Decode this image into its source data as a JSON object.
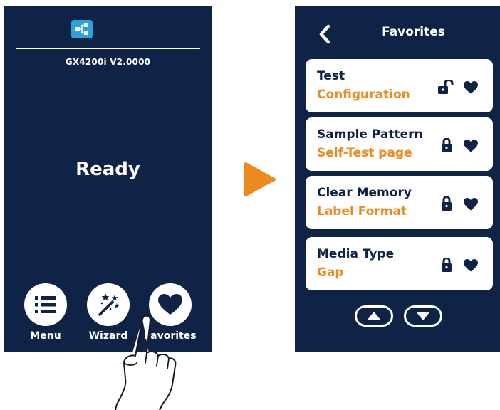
{
  "left_screen": {
    "model_version": "GX4200i V2.0000",
    "status": "Ready",
    "buttons": [
      {
        "label": "Menu",
        "icon": "menu-list-icon"
      },
      {
        "label": "Wizard",
        "icon": "magic-wand-icon"
      },
      {
        "label": "Favorites",
        "icon": "heart-icon"
      }
    ],
    "network_icon": "network-icon"
  },
  "right_screen": {
    "title": "Favorites",
    "items": [
      {
        "title": "Test",
        "subtitle": "Configuration",
        "lock": "unlocked",
        "favorite": true
      },
      {
        "title": "Sample Pattern",
        "subtitle": "Self-Test page",
        "lock": "locked",
        "favorite": true
      },
      {
        "title": "Clear Memory",
        "subtitle": "Label Format",
        "lock": "locked",
        "favorite": true
      },
      {
        "title": "Media Type",
        "subtitle": "Gap",
        "lock": "locked",
        "favorite": true
      }
    ],
    "scroll_buttons": [
      "scroll-up-icon",
      "scroll-down-icon"
    ]
  },
  "colors": {
    "panel_bg": "#0e2346",
    "accent_orange": "#ec8a1f",
    "network_icon_blue": "#2aa3dd",
    "text_white": "#ffffff"
  }
}
